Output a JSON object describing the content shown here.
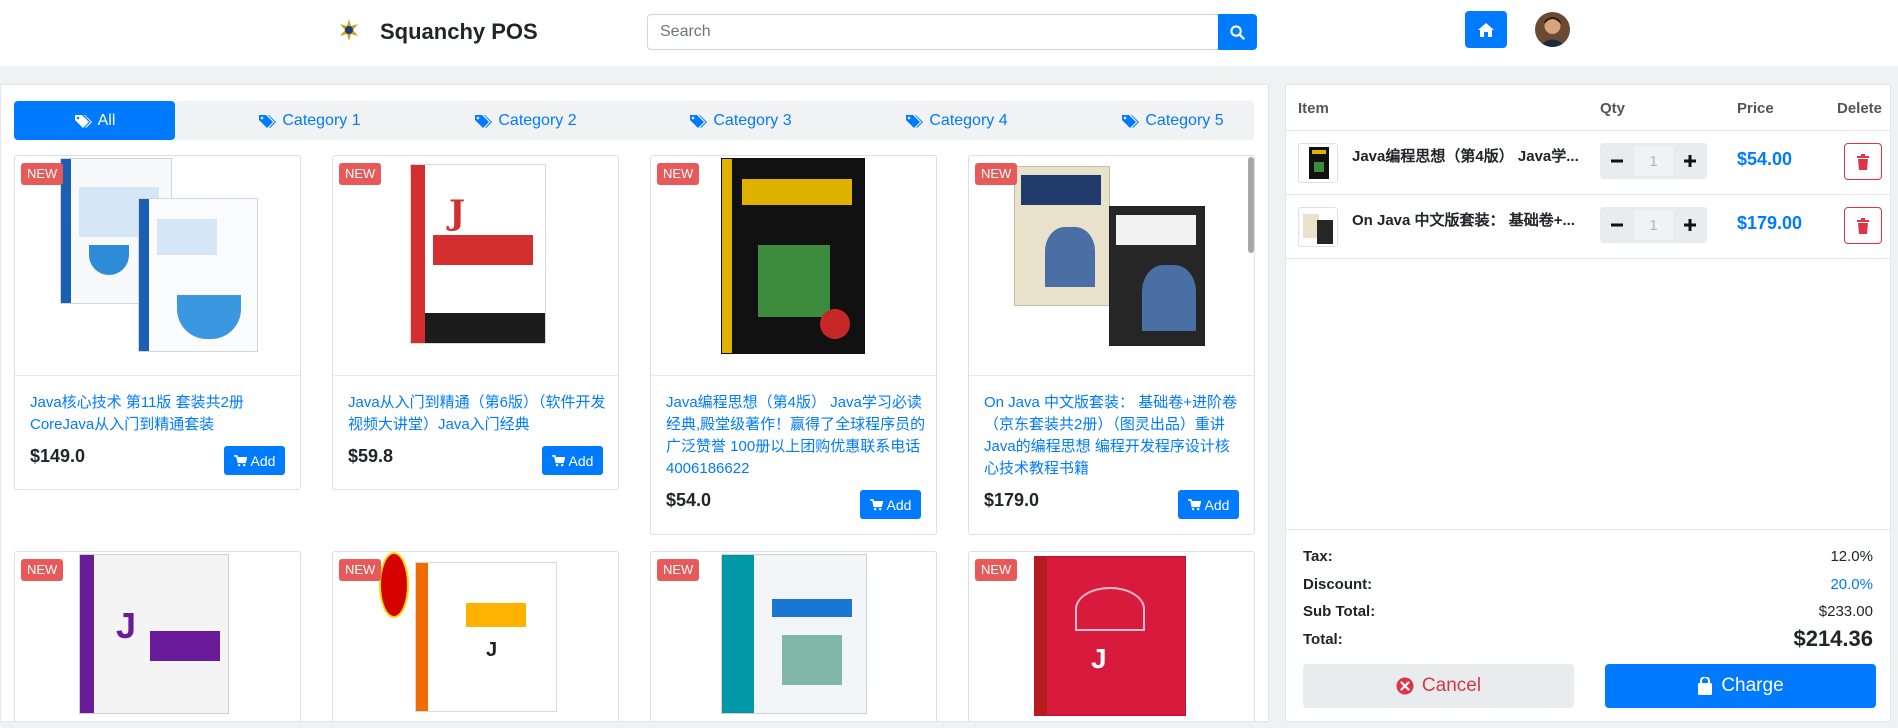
{
  "header": {
    "title": "Squanchy POS",
    "search_placeholder": "Search"
  },
  "categories": [
    {
      "label": "All",
      "active": true
    },
    {
      "label": "Category 1",
      "active": false
    },
    {
      "label": "Category 2",
      "active": false
    },
    {
      "label": "Category 3",
      "active": false
    },
    {
      "label": "Category 4",
      "active": false
    },
    {
      "label": "Category 5",
      "active": false
    }
  ],
  "products": [
    {
      "badge": "NEW",
      "title": "Java核心技术 第11版 套装共2册 CoreJava从入门到精通套装",
      "price": "$149.0",
      "add_label": "Add"
    },
    {
      "badge": "NEW",
      "title": "Java从入门到精通（第6版）（软件开发视频大讲堂）Java入门经典",
      "price": "$59.8",
      "add_label": "Add"
    },
    {
      "badge": "NEW",
      "title": "Java编程思想（第4版） Java学习必读经典,殿堂级著作！赢得了全球程序员的广泛赞誉 100册以上团购优惠联系电话4006186622",
      "price": "$54.0",
      "add_label": "Add"
    },
    {
      "badge": "NEW",
      "title": "On Java 中文版套装： 基础卷+进阶卷（京东套装共2册）（图灵出品）重讲Java的编程思想 编程开发程序设计核心技术教程书籍",
      "price": "$179.0",
      "add_label": "Add"
    },
    {
      "badge": "NEW"
    },
    {
      "badge": "NEW"
    },
    {
      "badge": "NEW"
    },
    {
      "badge": "NEW"
    }
  ],
  "cart": {
    "headers": {
      "item": "Item",
      "qty": "Qty",
      "price": "Price",
      "delete": "Delete"
    },
    "items": [
      {
        "name": "Java编程思想（第4版） Java学...",
        "qty": "1",
        "price": "$54.00"
      },
      {
        "name": "On Java 中文版套装： 基础卷+...",
        "qty": "1",
        "price": "$179.00"
      }
    ],
    "totals": {
      "tax_label": "Tax:",
      "tax": "12.0%",
      "discount_label": "Discount:",
      "discount": "20.0%",
      "subtotal_label": "Sub Total:",
      "subtotal": "$233.00",
      "total_label": "Total:",
      "total": "$214.36"
    },
    "cancel_label": "Cancel",
    "charge_label": "Charge"
  },
  "colors": {
    "primary": "#007bff",
    "danger": "#dc3545",
    "badge": "#e85a5a"
  }
}
